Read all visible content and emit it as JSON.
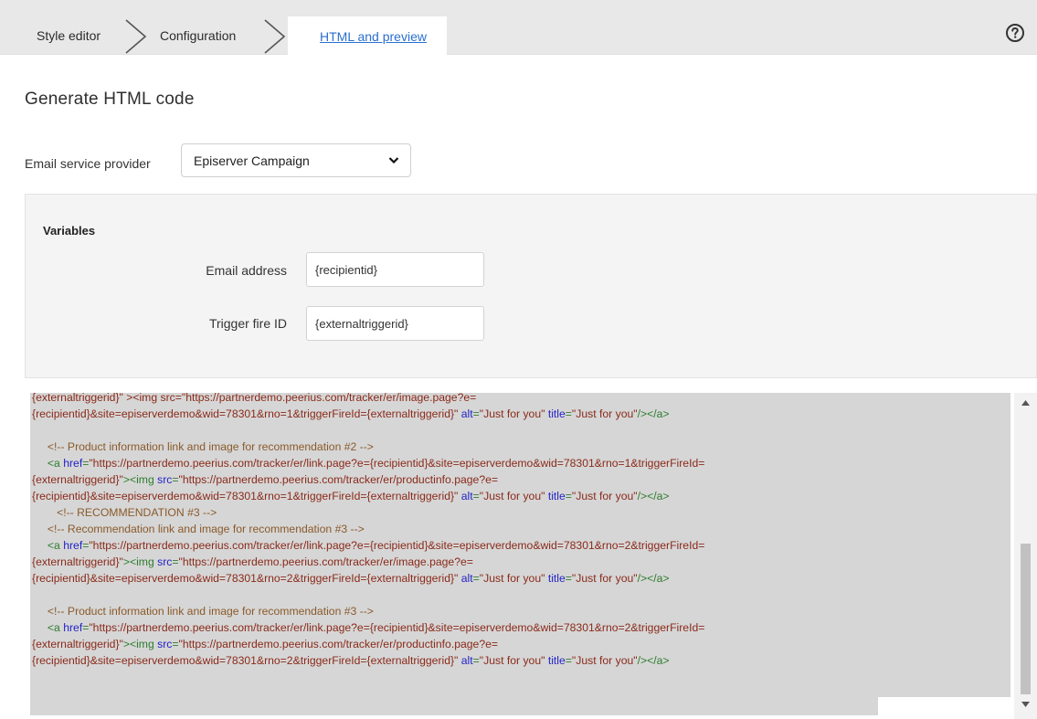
{
  "breadcrumb": {
    "steps": [
      {
        "label": "Style editor"
      },
      {
        "label": "Configuration"
      },
      {
        "label": "HTML and preview"
      }
    ]
  },
  "page": {
    "title": "Generate HTML code"
  },
  "esp": {
    "label": "Email service provider",
    "selected": "Episerver Campaign"
  },
  "variables": {
    "title": "Variables",
    "email_label": "Email address",
    "email_value": "{recipientid}",
    "trigger_label": "Trigger fire ID",
    "trigger_value": "{externaltriggerid}"
  },
  "code": {
    "lines": [
      [
        {
          "c": "t-text",
          "t": "{externaltriggerid}\" ><img src=\"https://partnerdemo.peerius.com/tracker/er/image.page?e="
        }
      ],
      [
        {
          "c": "t-text",
          "t": "{recipientid}&site=episerverdemo&wid=78301&rno=1&triggerFireId={externaltriggerid}\""
        },
        {
          "c": "t-attr",
          "t": " alt"
        },
        {
          "c": "t-tag",
          "t": "="
        },
        {
          "c": "t-str",
          "t": "\"Just for you\""
        },
        {
          "c": "t-attr",
          "t": " title"
        },
        {
          "c": "t-tag",
          "t": "="
        },
        {
          "c": "t-str",
          "t": "\"Just for you\""
        },
        {
          "c": "t-tag",
          "t": "/></a>"
        }
      ],
      [],
      [
        {
          "c": "t-cmt",
          "t": "     <!-- Product information link and image for recommendation #2 -->"
        }
      ],
      [
        {
          "c": "t-tag",
          "t": "     <a"
        },
        {
          "c": "t-attr",
          "t": " href"
        },
        {
          "c": "t-tag",
          "t": "="
        },
        {
          "c": "t-str",
          "t": "\"https://partnerdemo.peerius.com/tracker/er/link.page?e={recipientid}&site=episerverdemo&wid=78301&rno=1&triggerFireId="
        }
      ],
      [
        {
          "c": "t-str",
          "t": "{externaltriggerid}\""
        },
        {
          "c": "t-tag",
          "t": "><img"
        },
        {
          "c": "t-attr",
          "t": " src"
        },
        {
          "c": "t-tag",
          "t": "="
        },
        {
          "c": "t-str",
          "t": "\"https://partnerdemo.peerius.com/tracker/er/productinfo.page?e="
        }
      ],
      [
        {
          "c": "t-str",
          "t": "{recipientid}&site=episerverdemo&wid=78301&rno=1&triggerFireId={externaltriggerid}\""
        },
        {
          "c": "t-attr",
          "t": " alt"
        },
        {
          "c": "t-tag",
          "t": "="
        },
        {
          "c": "t-str",
          "t": "\"Just for you\""
        },
        {
          "c": "t-attr",
          "t": " title"
        },
        {
          "c": "t-tag",
          "t": "="
        },
        {
          "c": "t-str",
          "t": "\"Just for you\""
        },
        {
          "c": "t-tag",
          "t": "/></a>"
        }
      ],
      [
        {
          "c": "t-cmt",
          "t": "        <!-- RECOMMENDATION #3 -->"
        }
      ],
      [
        {
          "c": "t-cmt",
          "t": "     <!-- Recommendation link and image for recommendation #3 -->"
        }
      ],
      [
        {
          "c": "t-tag",
          "t": "     <a"
        },
        {
          "c": "t-attr",
          "t": " href"
        },
        {
          "c": "t-tag",
          "t": "="
        },
        {
          "c": "t-str",
          "t": "\"https://partnerdemo.peerius.com/tracker/er/link.page?e={recipientid}&site=episerverdemo&wid=78301&rno=2&triggerFireId="
        }
      ],
      [
        {
          "c": "t-str",
          "t": "{externaltriggerid}\""
        },
        {
          "c": "t-tag",
          "t": "><img"
        },
        {
          "c": "t-attr",
          "t": " src"
        },
        {
          "c": "t-tag",
          "t": "="
        },
        {
          "c": "t-str",
          "t": "\"https://partnerdemo.peerius.com/tracker/er/image.page?e="
        }
      ],
      [
        {
          "c": "t-str",
          "t": "{recipientid}&site=episerverdemo&wid=78301&rno=2&triggerFireId={externaltriggerid}\""
        },
        {
          "c": "t-attr",
          "t": " alt"
        },
        {
          "c": "t-tag",
          "t": "="
        },
        {
          "c": "t-str",
          "t": "\"Just for you\""
        },
        {
          "c": "t-attr",
          "t": " title"
        },
        {
          "c": "t-tag",
          "t": "="
        },
        {
          "c": "t-str",
          "t": "\"Just for you\""
        },
        {
          "c": "t-tag",
          "t": "/></a>"
        }
      ],
      [],
      [
        {
          "c": "t-cmt",
          "t": "     <!-- Product information link and image for recommendation #3 -->"
        }
      ],
      [
        {
          "c": "t-tag",
          "t": "     <a"
        },
        {
          "c": "t-attr",
          "t": " href"
        },
        {
          "c": "t-tag",
          "t": "="
        },
        {
          "c": "t-str",
          "t": "\"https://partnerdemo.peerius.com/tracker/er/link.page?e={recipientid}&site=episerverdemo&wid=78301&rno=2&triggerFireId="
        }
      ],
      [
        {
          "c": "t-str",
          "t": "{externaltriggerid}\""
        },
        {
          "c": "t-tag",
          "t": "><img"
        },
        {
          "c": "t-attr",
          "t": " src"
        },
        {
          "c": "t-tag",
          "t": "="
        },
        {
          "c": "t-str",
          "t": "\"https://partnerdemo.peerius.com/tracker/er/productinfo.page?e="
        }
      ],
      [
        {
          "c": "t-str",
          "t": "{recipientid}&site=episerverdemo&wid=78301&rno=2&triggerFireId={externaltriggerid}\""
        },
        {
          "c": "t-attr",
          "t": " alt"
        },
        {
          "c": "t-tag",
          "t": "="
        },
        {
          "c": "t-str",
          "t": "\"Just for you\""
        },
        {
          "c": "t-attr",
          "t": " title"
        },
        {
          "c": "t-tag",
          "t": "="
        },
        {
          "c": "t-str",
          "t": "\"Just for you\""
        },
        {
          "c": "t-tag",
          "t": "/></a>"
        }
      ]
    ]
  },
  "icons": {
    "help": "help-circle-icon",
    "chevron": "chevron-right-icon",
    "caret": "chevron-down-icon"
  },
  "colors": {
    "link": "#2a6fd0",
    "code_bg": "#d6d6d6",
    "panel_bg": "#f4f4f4"
  }
}
